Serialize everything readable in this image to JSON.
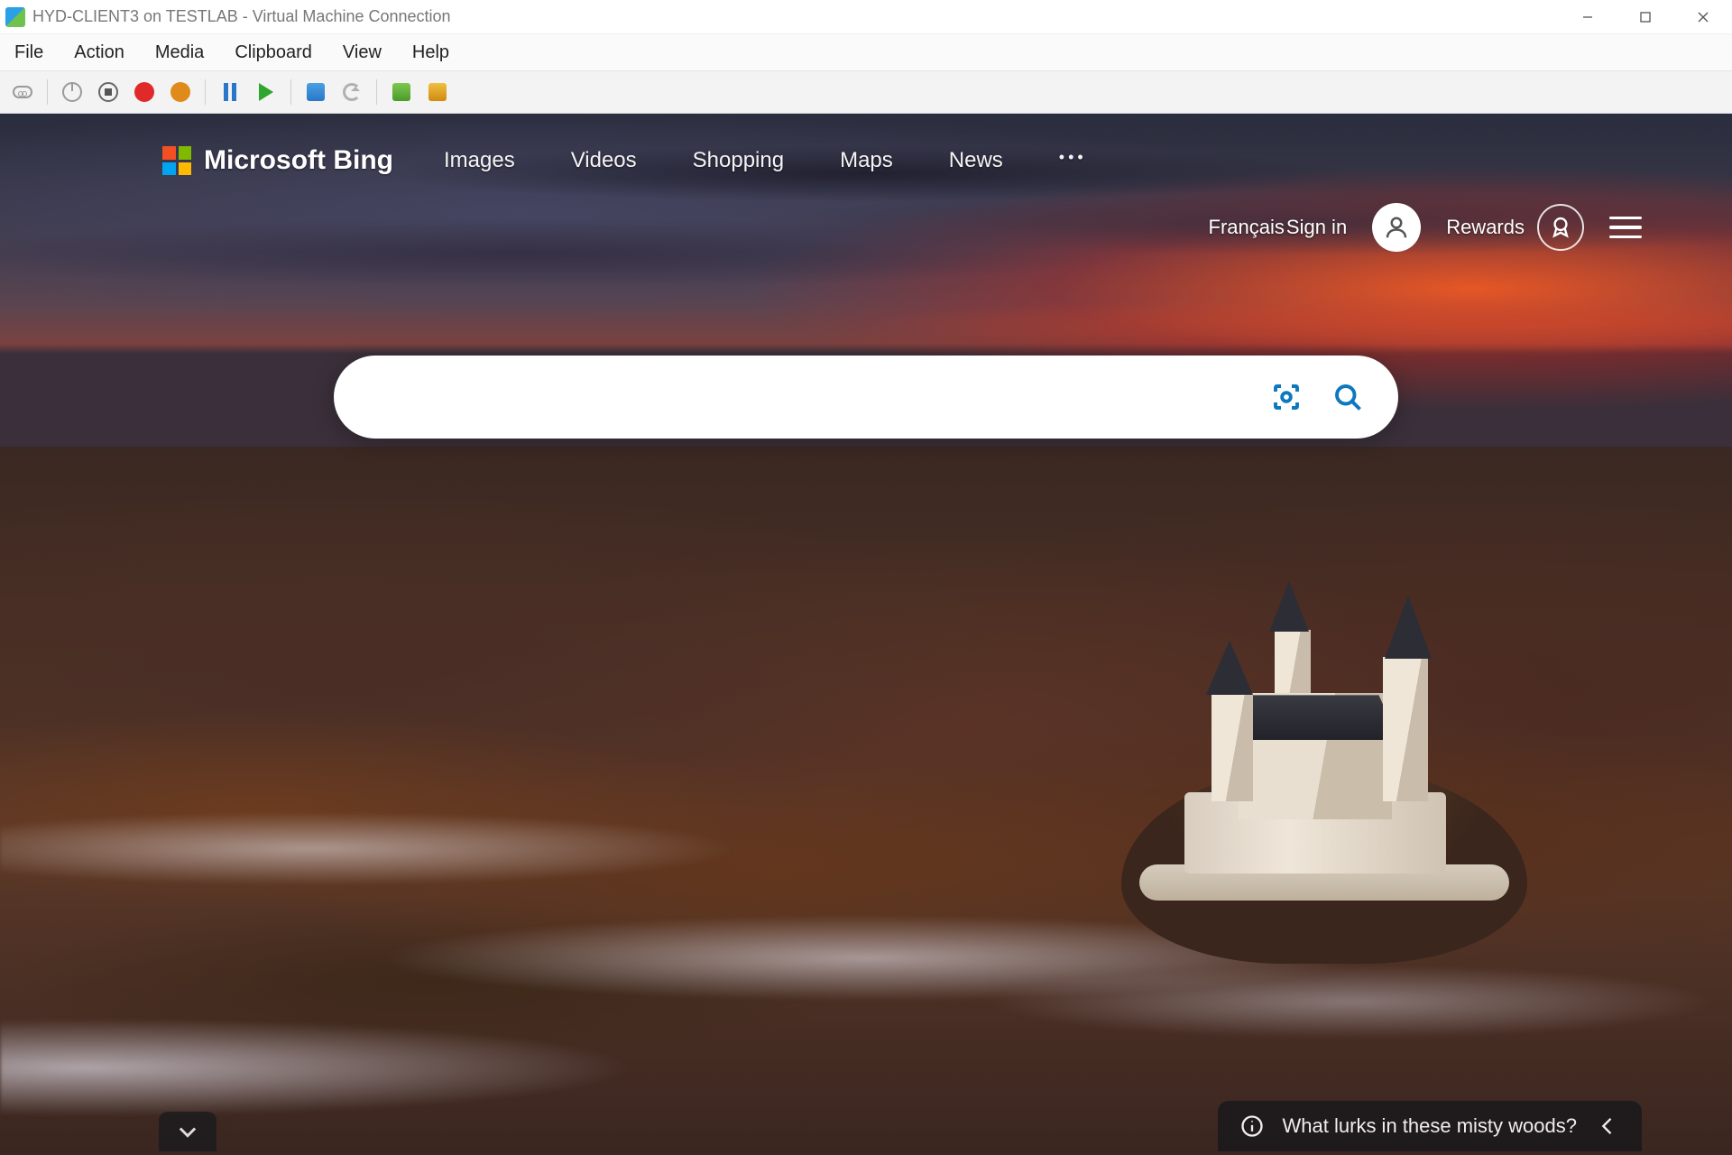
{
  "window": {
    "title": "HYD-CLIENT3 on TESTLAB - Virtual Machine Connection"
  },
  "menu": {
    "file": "File",
    "action": "Action",
    "media": "Media",
    "clipboard": "Clipboard",
    "view": "View",
    "help": "Help"
  },
  "bing": {
    "logo_text": "Microsoft Bing",
    "nav": {
      "images": "Images",
      "videos": "Videos",
      "shopping": "Shopping",
      "maps": "Maps",
      "news": "News",
      "more": "•••"
    },
    "language": "Français",
    "signin": "Sign in",
    "rewards": "Rewards",
    "search_placeholder": "",
    "teaser": "What lurks in these misty woods?"
  }
}
